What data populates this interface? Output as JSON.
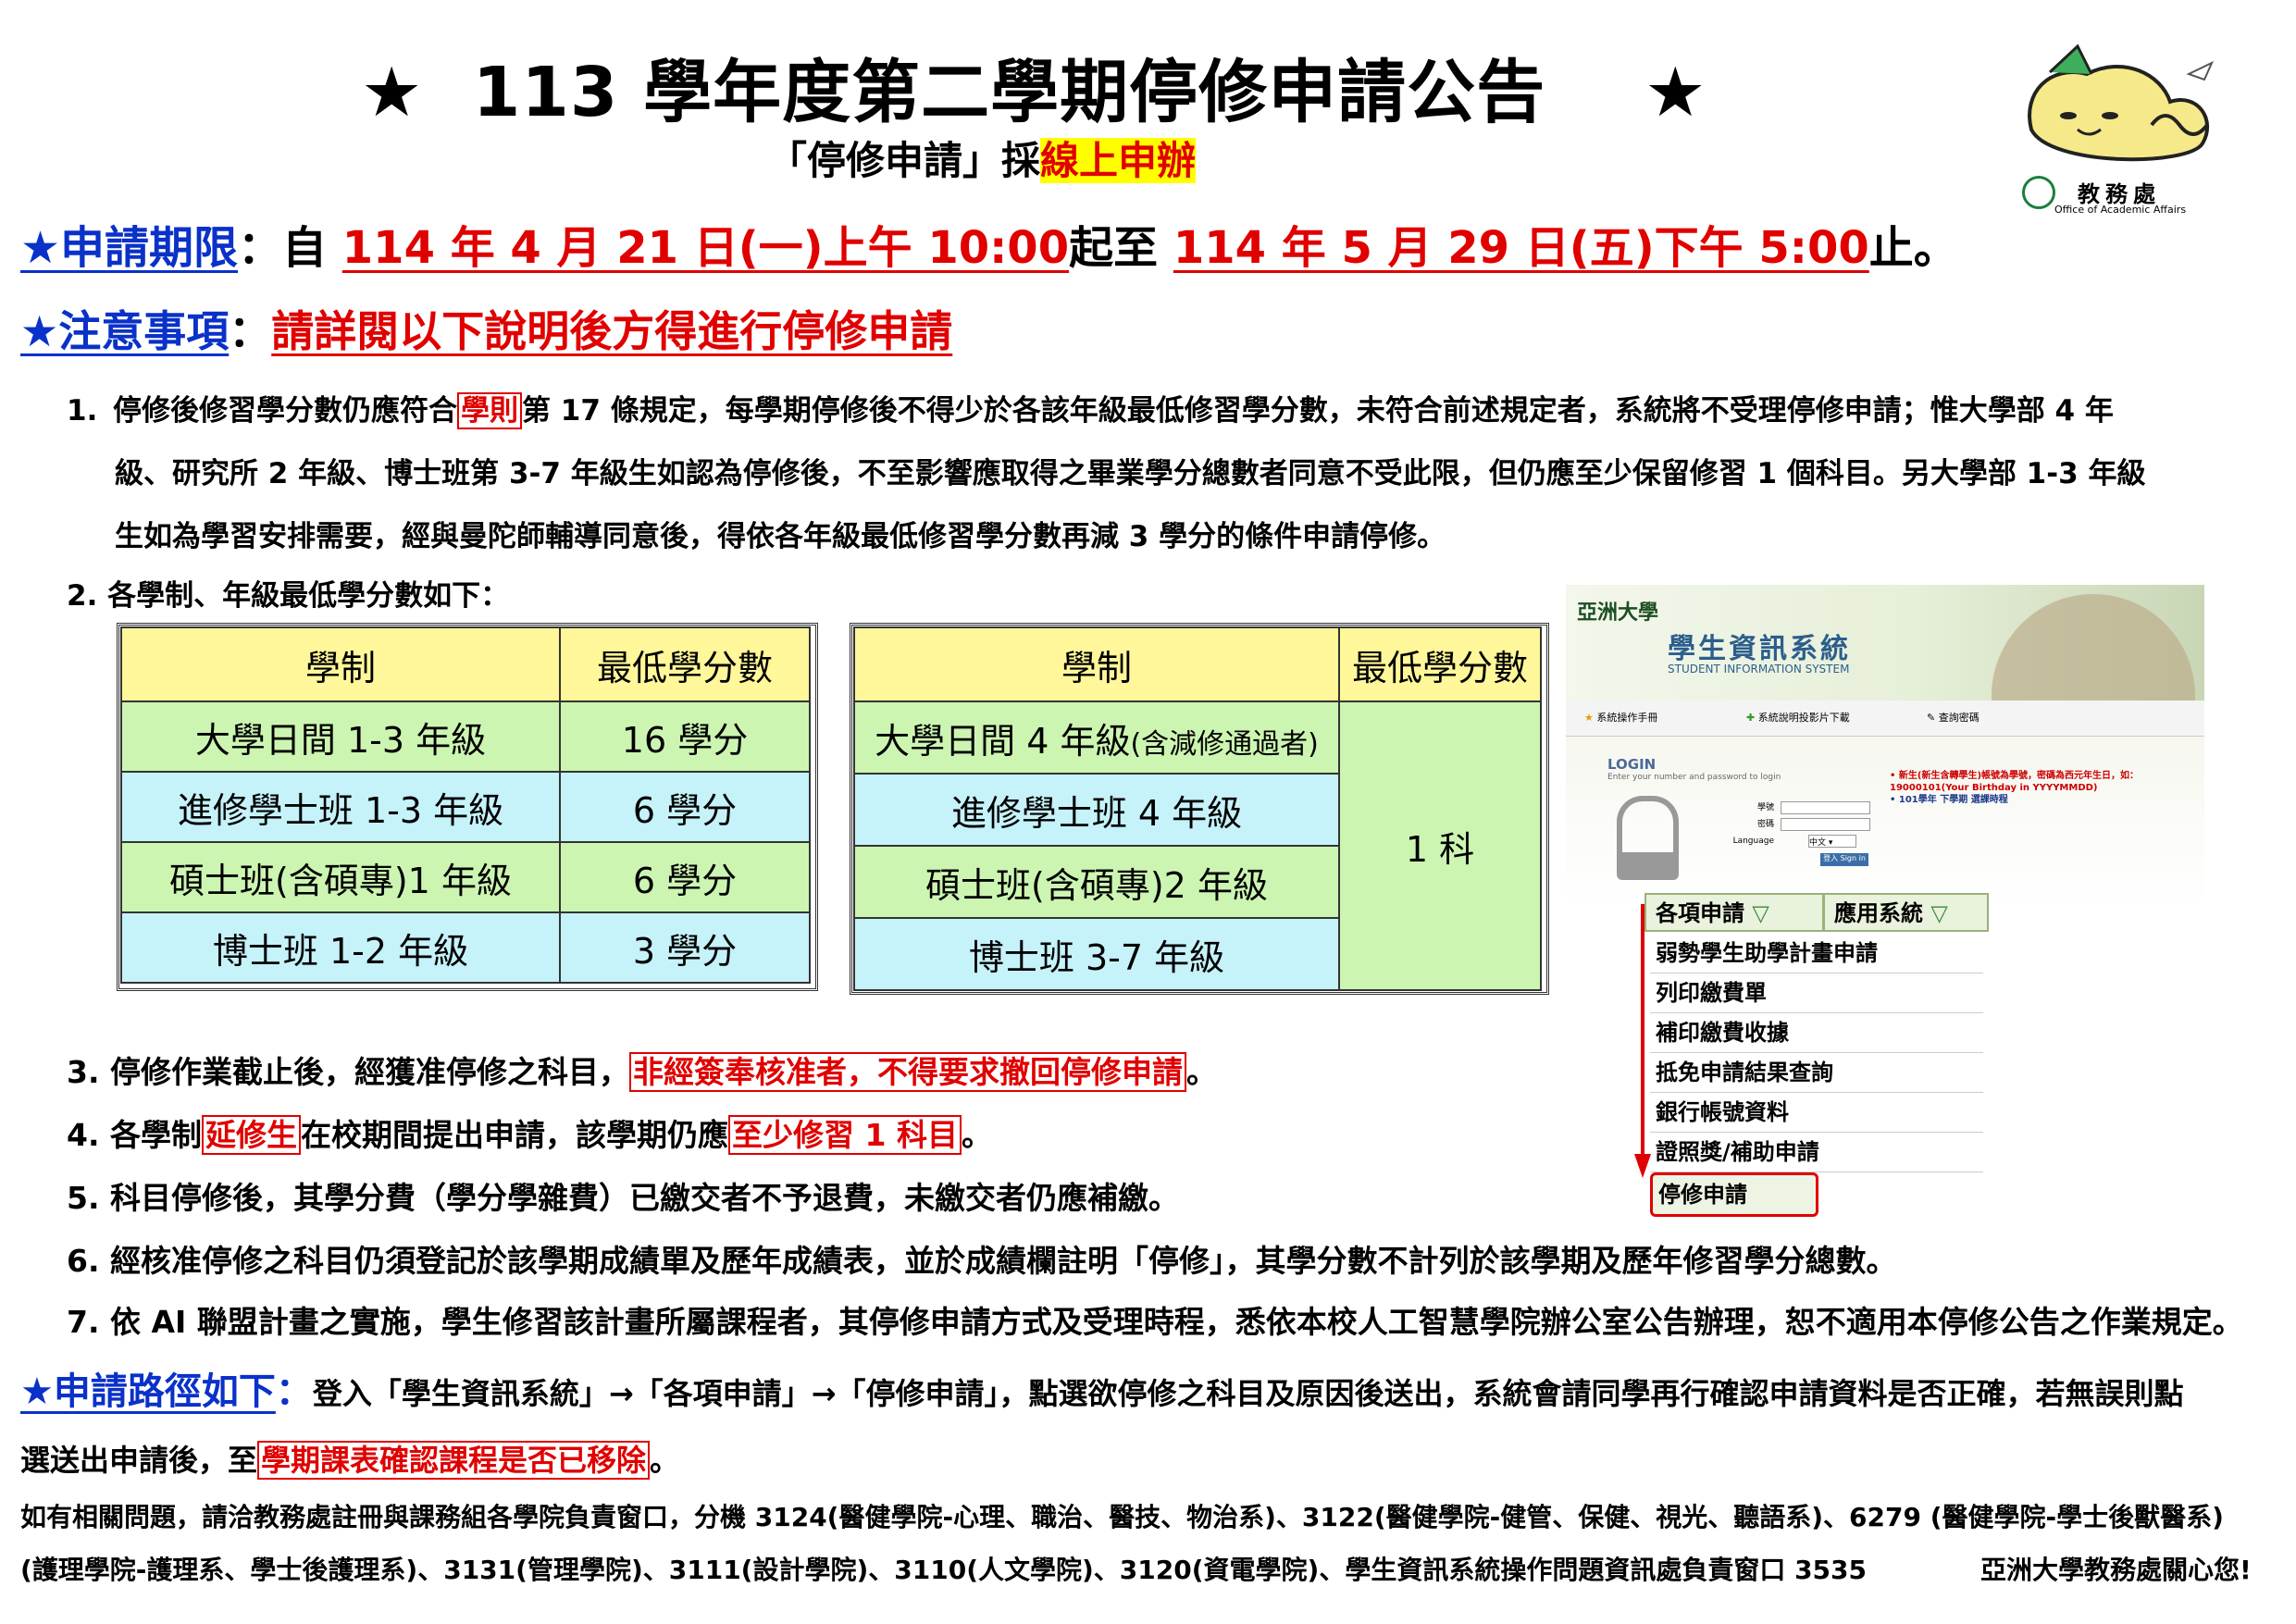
{
  "header": {
    "star_left": "★",
    "title": "113 學年度第二學期停修申請公告",
    "star_right": "★",
    "subtitle_pre": "「停修申請」採",
    "subtitle_highlight": "線上申辦",
    "logo_org": "教務處",
    "logo_org_en": "Office of Academic Affairs"
  },
  "period": {
    "label": "★申請期限",
    "colon": "：自",
    "start": "114 年 4 月 21 日(一)上午 10:00",
    "mid": "起至",
    "end": "114 年 5 月 29 日(五)下午 5:00",
    "tail": "止。"
  },
  "notice": {
    "label": "★注意事項",
    "colon": "：",
    "text": "請詳閱以下說明後方得進行停修申請"
  },
  "item1": {
    "num": "1.",
    "a": "停修後修習學分數仍應符合",
    "boxed": "學則",
    "b": "第 17 條規定，每學期停修後不得少於各該年級最低修習學分數，未符合前述規定者，系統將不受理停修申請；惟大學部 4 年",
    "line2": "級、研究所 2 年級、博士班第 3-7 年級生如認為停修後，不至影響應取得之畢業學分總數者同意不受此限，但仍應至少保留修習 1 個科目。另大學部 1-3 年級",
    "line3": "生如為學習安排需要，經與曼陀師輔導同意後，得依各年級最低修習學分數再減 3 學分的條件申請停修。"
  },
  "item2": {
    "text": "2.  各學制、年級最低學分數如下："
  },
  "table_left": {
    "headers": [
      "學制",
      "最低學分數"
    ],
    "rows": [
      [
        "大學日間 1-3 年級",
        "16 學分"
      ],
      [
        "進修學士班 1-3 年級",
        "6 學分"
      ],
      [
        "碩士班(含碩專)1 年級",
        "6 學分"
      ],
      [
        "博士班 1-2 年級",
        "3 學分"
      ]
    ]
  },
  "table_right": {
    "headers": [
      "學制",
      "最低學分數"
    ],
    "rows": [
      "大學日間 4 年級",
      "進修學士班 4 年級",
      "碩士班(含碩專)2 年級",
      "博士班 3-7 年級"
    ],
    "row0_note": "(含減修通過者)",
    "merged_value": "1 科"
  },
  "screenshot": {
    "univ": "亞洲大學",
    "system": "學生資訊系統",
    "system_en": "STUDENT INFORMATION SYSTEM",
    "nav": [
      "系統操作手冊",
      "系統說明投影片下載",
      "查詢密碼"
    ],
    "login_title": "LOGIN",
    "login_hint": "Enter your number and password to login",
    "fields": [
      "學號",
      "密碼",
      "Language"
    ],
    "lang_value": "中文",
    "login_btn": "登入 Sign in",
    "news1": "新生(新生含轉學生)帳號為學號，密碼為西元年生日，如：19000101(Your Birthday in YYYYMMDD)",
    "news2": "101學年 下學期 選課時程",
    "tabs": [
      "各項申請",
      "應用系統"
    ],
    "menu": [
      "弱勢學生助學計畫申請",
      "列印繳費單",
      "補印繳費收據",
      "抵免申請結果查詢",
      "銀行帳號資料",
      "證照獎/補助申請",
      "停修申請"
    ]
  },
  "item3": {
    "a": "3. 停修作業截止後，經獲准停修之科目，",
    "boxed": "非經簽奉核准者，不得要求撤回停修申請",
    "b": "。"
  },
  "item4": {
    "a": "4. 各學制",
    "boxed1": "延修生",
    "b": "在校期間提出申請，該學期仍應",
    "boxed2": "至少修習 1 科目",
    "c": "。"
  },
  "item5": "5. 科目停修後，其學分費（學分學雜費）已繳交者不予退費，未繳交者仍應補繳。",
  "item6": "6. 經核准停修之科目仍須登記於該學期成績單及歷年成績表，並於成績欄註明「停修」，其學分數不計列於該學期及歷年修習學分總數。",
  "item7": "7. 依 AI 聯盟計畫之實施，學生修習該計畫所屬課程者，其停修申請方式及受理時程，悉依本校人工智慧學院辦公室公告辦理，恕不適用本停修公告之作業規定。",
  "path": {
    "label": "★申請路徑如下",
    "colon": "：",
    "a": "登入「學生資訊系統」→「各項申請」→「停修申請」，點選欲停修之科目及原因後送出，系統會請同學再行確認申請資料是否正確，若無誤則點",
    "b": "選送出申請後，至",
    "boxed": "學期課表確認課程是否已移除",
    "c": "。"
  },
  "footer": {
    "line1": "如有相關問題，請洽教務處註冊與課務組各學院負責窗口，分機 3124(醫健學院-心理、職治、醫技、物治系)、3122(醫健學院-健管、保健、視光、聽語系)、6279 (醫健學院-學士後獸醫系)",
    "line2": "(護理學院-護理系、學士後護理系)、3131(管理學院)、3111(設計學院)、3110(人文學院)、3120(資電學院)、學生資訊系統操作問題資訊處負責窗口 3535",
    "sign": "亞洲大學教務處關心您!"
  }
}
